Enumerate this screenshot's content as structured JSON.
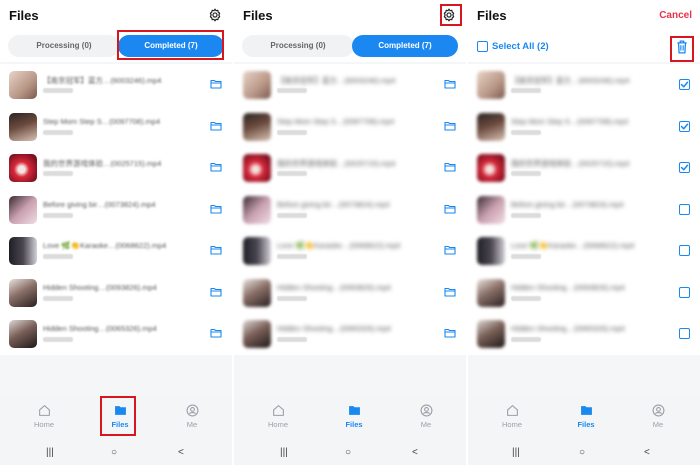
{
  "panel1": {
    "title": "Files",
    "tabs": {
      "processing": "Processing (0)",
      "completed": "Completed (7)"
    }
  },
  "panel2": {
    "title": "Files",
    "tabs": {
      "processing": "Processing (0)",
      "completed": "Completed (7)"
    }
  },
  "panel3": {
    "title": "Files",
    "cancel": "Cancel",
    "select_all": "Select All (2)"
  },
  "files": [
    {
      "name": "【南京冠军】蓝方…(6003246).mp4",
      "checked": true
    },
    {
      "name": "Step Mom Step S…(0097708).mp4",
      "checked": true
    },
    {
      "name": "我的世界游戏体验…(0025715).mp4",
      "checked": true
    },
    {
      "name": "Before giving bir…(0073824).mp4",
      "checked": false
    },
    {
      "name": "Love 🌿👏Karaoke…(0068622).mp4",
      "checked": false
    },
    {
      "name": "Hidden Shooting…(0093826).mp4",
      "checked": false
    },
    {
      "name": "Hidden Shooting…(0065326).mp4",
      "checked": false
    }
  ],
  "nav": {
    "home": "Home",
    "files": "Files",
    "me": "Me"
  },
  "system": {
    "recent": "|||",
    "home": "○",
    "back": "<"
  },
  "colors": {
    "accent": "#1a88f0",
    "cancel": "#e8334a",
    "highlight": "#d8161f"
  },
  "icons": [
    "gear-icon",
    "folder-icon",
    "trash-icon",
    "checkbox-icon",
    "home-icon",
    "files-icon",
    "me-icon"
  ]
}
